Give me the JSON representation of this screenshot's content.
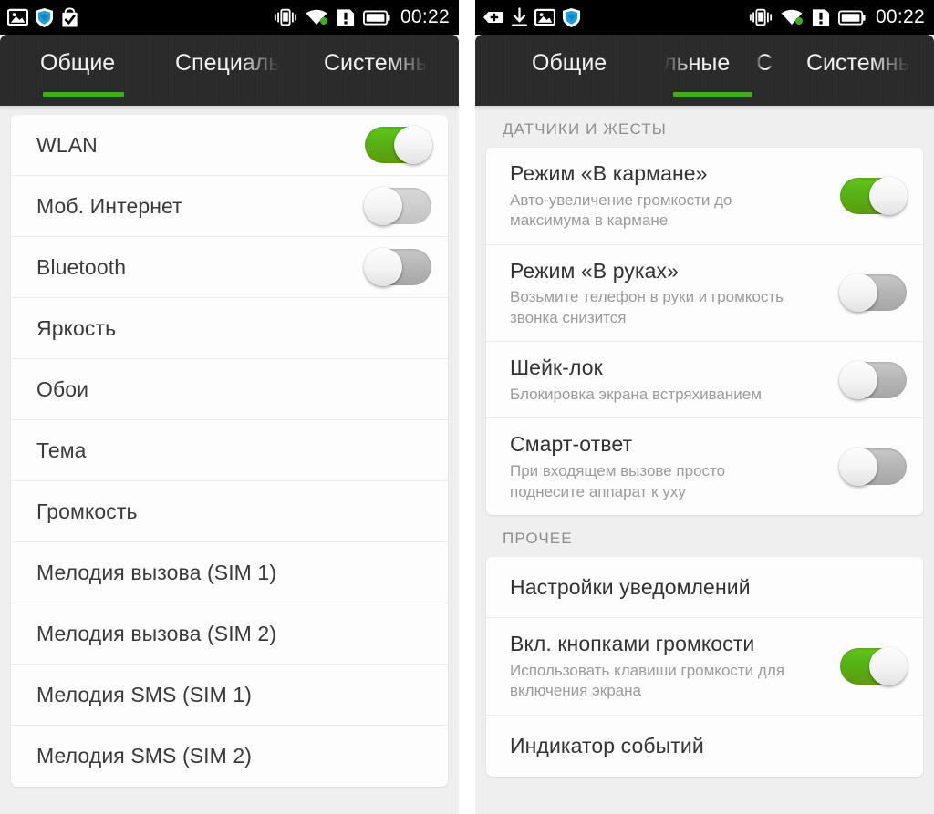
{
  "left_panel": {
    "statusbar": {
      "left_icons": [
        "image-icon",
        "shield-icon",
        "shopping-bag-check-icon"
      ],
      "right_icons": [
        "vibrate-icon",
        "wifi-icon",
        "sim-alert-icon",
        "battery-icon"
      ],
      "clock": "00:22"
    },
    "tabs": [
      {
        "label": "Общие",
        "active": true
      },
      {
        "label": "Специаль",
        "active": false
      },
      {
        "label": "Системнь",
        "active": false
      }
    ],
    "accent_color": "#3fae1c",
    "items": [
      {
        "label": "WLAN",
        "toggle": "on"
      },
      {
        "label": "Моб. Интернет",
        "toggle": "off-light"
      },
      {
        "label": "Bluetooth",
        "toggle": "off"
      },
      {
        "label": "Яркость",
        "toggle": null
      },
      {
        "label": "Обои",
        "toggle": null
      },
      {
        "label": "Тема",
        "toggle": null
      },
      {
        "label": "Громкость",
        "toggle": null
      },
      {
        "label": "Мелодия вызова (SIM 1)",
        "toggle": null
      },
      {
        "label": "Мелодия вызова (SIM 2)",
        "toggle": null
      },
      {
        "label": "Мелодия SMS (SIM 1)",
        "toggle": null
      },
      {
        "label": "Мелодия SMS (SIM 2)",
        "toggle": null
      }
    ]
  },
  "right_panel": {
    "statusbar": {
      "left_icons": [
        "plus-badge-icon",
        "download-icon",
        "image-icon",
        "shield-icon"
      ],
      "right_icons": [
        "vibrate-icon",
        "wifi-icon",
        "sim-alert-icon",
        "battery-icon"
      ],
      "clock": "00:22"
    },
    "tabs": [
      {
        "label": "Общие",
        "active": false
      },
      {
        "label": "льные",
        "active": true
      },
      {
        "label": "С",
        "active": false
      },
      {
        "label": "Системнь",
        "active": false
      }
    ],
    "accent_color": "#3fae1c",
    "sections": [
      {
        "header": "ДАТЧИКИ И ЖЕСТЫ",
        "items": [
          {
            "title": "Режим «В кармане»",
            "subtitle": "Авто-увеличение громкости до максимума в кармане",
            "toggle": "on"
          },
          {
            "title": "Режим «В руках»",
            "subtitle": "Возьмите телефон в руки и громкость звонка снизится",
            "toggle": "off"
          },
          {
            "title": "Шейк-лок",
            "subtitle": "Блокировка экрана встряхиванием",
            "toggle": "off"
          },
          {
            "title": "Смарт-ответ",
            "subtitle": "При входящем вызове просто поднесите аппарат к уху",
            "toggle": "off"
          }
        ]
      },
      {
        "header": "ПРОЧЕЕ",
        "items": [
          {
            "title": "Настройки уведомлений",
            "subtitle": null,
            "toggle": null
          },
          {
            "title": "Вкл. кнопками громкости",
            "subtitle": "Использовать клавиши громкости для включения экрана",
            "toggle": "on"
          },
          {
            "title": "Индикатор событий",
            "subtitle": null,
            "toggle": null
          }
        ]
      }
    ]
  }
}
